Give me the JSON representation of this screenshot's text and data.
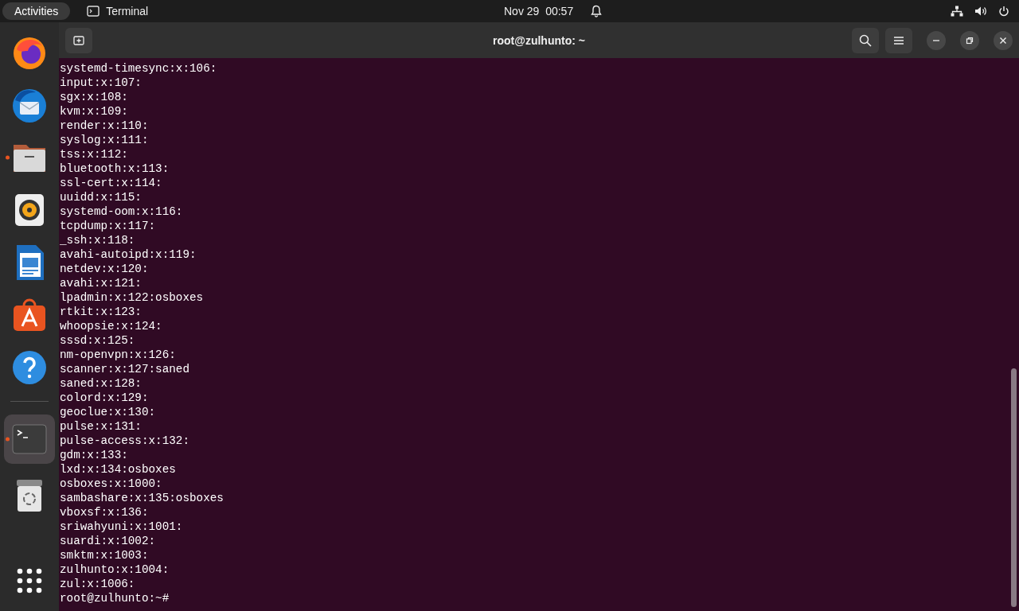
{
  "top_bar": {
    "activities": "Activities",
    "app_name": "Terminal",
    "clock": "Nov 29  00:57"
  },
  "dock": [
    {
      "kind": "firefox",
      "running": false,
      "selected": false
    },
    {
      "kind": "mail",
      "running": false,
      "selected": false
    },
    {
      "kind": "files",
      "running": true,
      "selected": false
    },
    {
      "kind": "music",
      "running": false,
      "selected": false
    },
    {
      "kind": "writer",
      "running": false,
      "selected": false
    },
    {
      "kind": "store",
      "running": false,
      "selected": false
    },
    {
      "kind": "help",
      "running": false,
      "selected": false
    },
    {
      "kind": "separator"
    },
    {
      "kind": "terminal",
      "running": true,
      "selected": true
    },
    {
      "kind": "trash",
      "running": false,
      "selected": false
    }
  ],
  "window": {
    "title": "root@zulhunto: ~"
  },
  "terminal": {
    "lines": [
      "systemd-timesync:x:106:",
      "input:x:107:",
      "sgx:x:108:",
      "kvm:x:109:",
      "render:x:110:",
      "syslog:x:111:",
      "tss:x:112:",
      "bluetooth:x:113:",
      "ssl-cert:x:114:",
      "uuidd:x:115:",
      "systemd-oom:x:116:",
      "tcpdump:x:117:",
      "_ssh:x:118:",
      "avahi-autoipd:x:119:",
      "netdev:x:120:",
      "avahi:x:121:",
      "lpadmin:x:122:osboxes",
      "rtkit:x:123:",
      "whoopsie:x:124:",
      "sssd:x:125:",
      "nm-openvpn:x:126:",
      "scanner:x:127:saned",
      "saned:x:128:",
      "colord:x:129:",
      "geoclue:x:130:",
      "pulse:x:131:",
      "pulse-access:x:132:",
      "gdm:x:133:",
      "lxd:x:134:osboxes",
      "osboxes:x:1000:",
      "sambashare:x:135:osboxes",
      "vboxsf:x:136:",
      "sriwahyuni:x:1001:",
      "suardi:x:1002:",
      "smktm:x:1003:",
      "zulhunto:x:1004:",
      "zul:x:1006:"
    ],
    "prompt": "root@zulhunto:~#"
  }
}
